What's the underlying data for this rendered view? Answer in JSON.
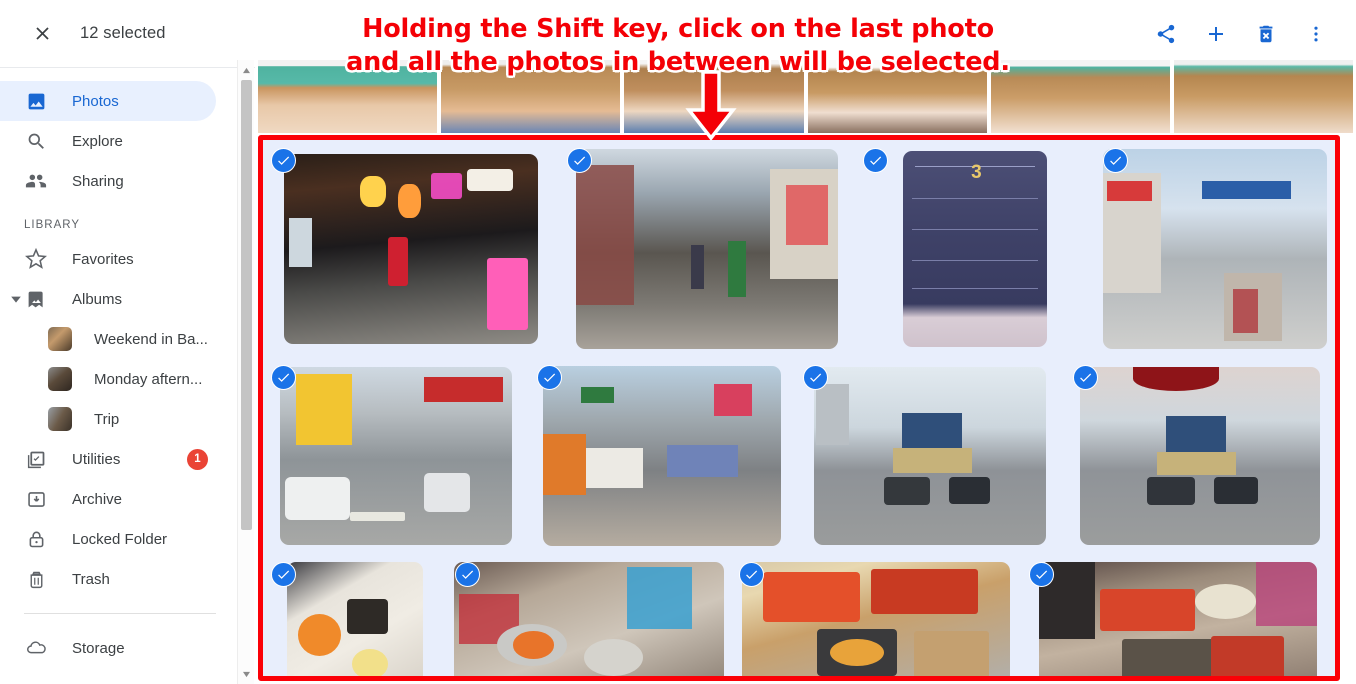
{
  "header": {
    "close_icon": "close-icon",
    "selection_count_label": "12 selected",
    "actions": [
      {
        "name": "share-button",
        "icon": "share-icon"
      },
      {
        "name": "add-to-button",
        "icon": "plus-icon"
      },
      {
        "name": "delete-button",
        "icon": "trash-icon"
      },
      {
        "name": "more-options-button",
        "icon": "more-vertical-icon"
      }
    ],
    "action_color": "#1967d2"
  },
  "sidebar": {
    "primary_items": [
      {
        "label": "Photos",
        "icon": "photo-icon",
        "active": true
      },
      {
        "label": "Explore",
        "icon": "search-icon",
        "active": false
      },
      {
        "label": "Sharing",
        "icon": "people-icon",
        "active": false
      }
    ],
    "library_label": "LIBRARY",
    "library_items": [
      {
        "label": "Favorites",
        "icon": "star-icon"
      },
      {
        "label": "Albums",
        "icon": "album-icon",
        "expanded": true
      }
    ],
    "albums": [
      {
        "label": "Weekend in Ba..."
      },
      {
        "label": "Monday aftern..."
      },
      {
        "label": "Trip"
      }
    ],
    "utility_items": [
      {
        "label": "Utilities",
        "icon": "utilities-icon",
        "badge": "1"
      },
      {
        "label": "Archive",
        "icon": "archive-icon"
      },
      {
        "label": "Locked Folder",
        "icon": "lock-icon"
      },
      {
        "label": "Trash",
        "icon": "trash-outline-icon"
      }
    ],
    "footer_items": [
      {
        "label": "Storage",
        "icon": "cloud-icon"
      }
    ],
    "active_color": "#1967d2",
    "active_bg": "#e8f0fe",
    "badge_color": "#ea4335"
  },
  "annotation": {
    "line1": "Holding the Shift key, click on the last photo",
    "line2": "and all the photos in between will be selected.",
    "color": "#f40006",
    "arrow_icon": "down-arrow-icon",
    "highlight_box_color": "#fb0007"
  },
  "grid": {
    "selected_cell_bg": "#e8eefc",
    "check_icon": "check-circle-icon",
    "check_color": "#1a73e8",
    "top_partial_row": [
      {
        "name": "photo-hand-nut-1"
      },
      {
        "name": "photo-hand-nut-2"
      },
      {
        "name": "photo-hand-nut-3"
      },
      {
        "name": "photo-hand-nut-4"
      },
      {
        "name": "photo-hand-nut-5"
      },
      {
        "name": "photo-hand-nut-6"
      }
    ],
    "rows": [
      [
        {
          "name": "photo-market-lanterns",
          "selected": true
        },
        {
          "name": "photo-alley-shops",
          "selected": true
        },
        {
          "name": "photo-station-sign",
          "selected": true
        },
        {
          "name": "photo-street-arcade",
          "selected": true
        }
      ],
      [
        {
          "name": "photo-street-scooters",
          "selected": true
        },
        {
          "name": "photo-street-stalls",
          "selected": true
        },
        {
          "name": "photo-market-gate-1",
          "selected": true
        },
        {
          "name": "photo-market-gate-2",
          "selected": true
        }
      ],
      [
        {
          "name": "photo-food-bowls",
          "selected": true
        },
        {
          "name": "photo-food-stall-1",
          "selected": true
        },
        {
          "name": "photo-food-skewers",
          "selected": true
        },
        {
          "name": "photo-food-market",
          "selected": true
        }
      ]
    ]
  },
  "scrollbar": {
    "up_arrow_icon": "scroll-up-icon",
    "down_arrow_icon": "scroll-down-icon",
    "thumb": "scroll-thumb"
  }
}
